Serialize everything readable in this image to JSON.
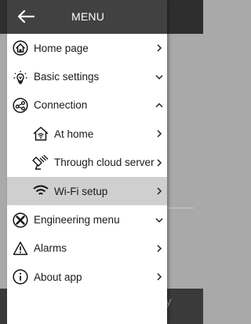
{
  "header": {
    "title": "MENU",
    "back_icon": "arrow-left-icon"
  },
  "menu": [
    {
      "label": "Home page",
      "icon": "home-icon",
      "chevron": "right"
    },
    {
      "label": "Basic settings",
      "icon": "bulb-settings-icon",
      "chevron": "down"
    },
    {
      "label": "Connection",
      "icon": "share-connection-icon",
      "chevron": "up"
    },
    {
      "label": "At home",
      "icon": "home-wifi-icon",
      "chevron": "right",
      "level": 1
    },
    {
      "label": "Through cloud server",
      "icon": "satellite-icon",
      "chevron": "right",
      "level": 1
    },
    {
      "label": "Wi-Fi setup",
      "icon": "wifi-icon",
      "chevron": "right",
      "level": 1,
      "active": true
    },
    {
      "label": "Engineering menu",
      "icon": "tools-icon",
      "chevron": "down"
    },
    {
      "label": "Alarms",
      "icon": "warning-icon",
      "chevron": "right"
    },
    {
      "label": "About app",
      "icon": "info-icon",
      "chevron": "right"
    }
  ],
  "background_fragment": "y",
  "colors": {
    "header": "#414141",
    "active_row": "#cfcfcf",
    "backdrop": "#a9a9a9"
  }
}
